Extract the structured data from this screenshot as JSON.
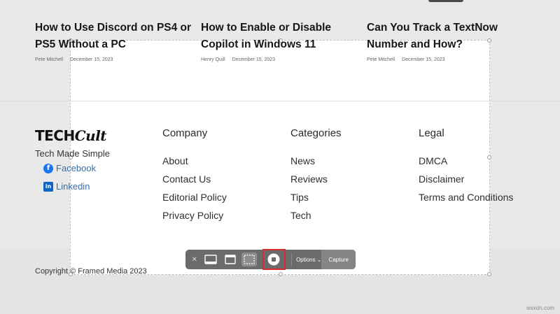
{
  "articles": [
    {
      "title": "How to Use Discord on PS4 or PS5 Without a PC",
      "author": "Pete Mitchell",
      "date": "December 15, 2023"
    },
    {
      "title": "How to Enable or Disable Copilot in Windows 11",
      "author": "Henry Quill",
      "date": "December 15, 2023"
    },
    {
      "title": "Can You Track a TextNow Number and How?",
      "author": "Pete Mitchell",
      "date": "December 15, 2023"
    }
  ],
  "brand": {
    "logo_left": "TECH",
    "logo_right": "Cult",
    "tagline": "Tech Made Simple"
  },
  "social": [
    {
      "icon": "facebook-icon",
      "label": "Facebook",
      "glyph": "f"
    },
    {
      "icon": "linkedin-icon",
      "label": "Linkedin",
      "glyph": "in"
    }
  ],
  "footer": {
    "company": {
      "heading": "Company",
      "links": [
        "About",
        "Contact Us",
        "Editorial Policy",
        "Privacy Policy"
      ]
    },
    "categories": {
      "heading": "Categories",
      "links": [
        "News",
        "Reviews",
        "Tips",
        "Tech"
      ]
    },
    "legal": {
      "heading": "Legal",
      "links": [
        "DMCA",
        "Disclaimer",
        "Terms and Conditions"
      ]
    }
  },
  "copyright": "Copyright © Framed Media 2023",
  "toolbar": {
    "close_glyph": "✕",
    "options_label": "Options",
    "options_caret": "⌄",
    "capture_label": "Capture",
    "record_highlight_color": "#e0292b"
  },
  "watermark": "wsxdn.com"
}
